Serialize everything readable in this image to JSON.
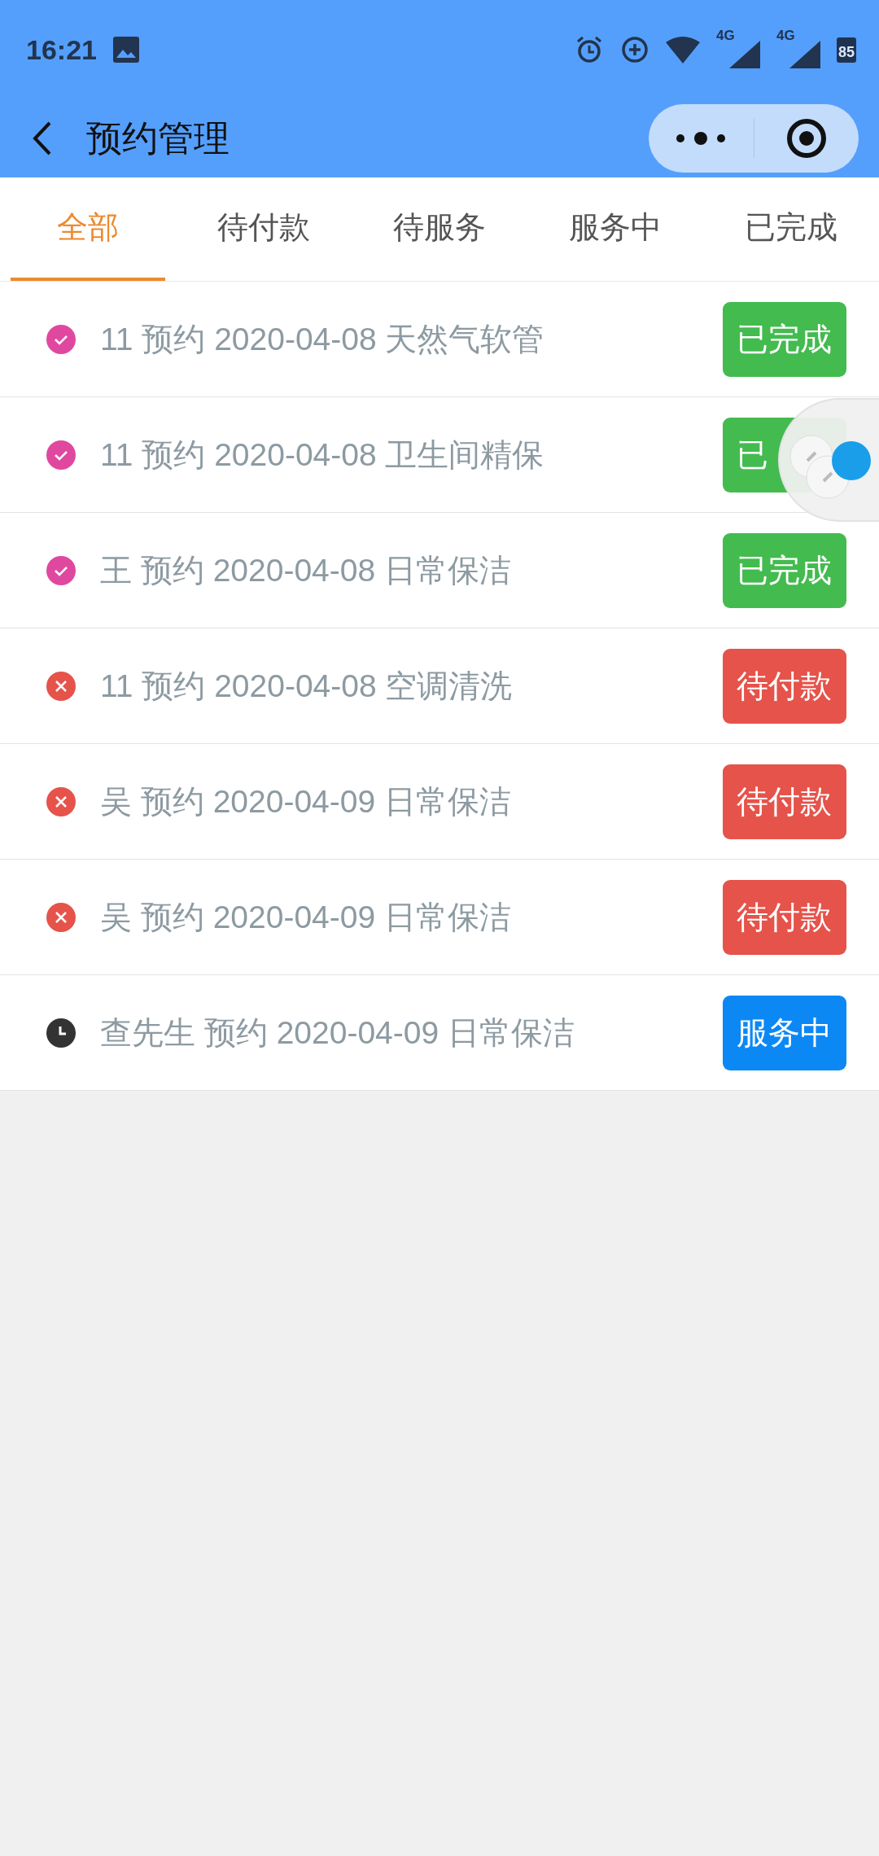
{
  "status_bar": {
    "time": "16:21",
    "networks": [
      "4G",
      "4G"
    ],
    "battery": "85"
  },
  "nav": {
    "title": "预约管理"
  },
  "tabs": [
    {
      "label": "全部",
      "selected": true
    },
    {
      "label": "待付款",
      "selected": false
    },
    {
      "label": "待服务",
      "selected": false
    },
    {
      "label": "服务中",
      "selected": false
    },
    {
      "label": "已完成",
      "selected": false
    }
  ],
  "appointments": [
    {
      "text": "11 预约 2020-04-08 天然气软管",
      "kind": "done",
      "badge": "已完成"
    },
    {
      "text": "11 预约 2020-04-08 卫生间精保",
      "kind": "done",
      "badge": "已"
    },
    {
      "text": "王 预约 2020-04-08 日常保洁",
      "kind": "done",
      "badge": "已完成"
    },
    {
      "text": "11 预约 2020-04-08 空调清洗",
      "kind": "unpaid",
      "badge": "待付款"
    },
    {
      "text": "吴 预约 2020-04-09 日常保洁",
      "kind": "unpaid",
      "badge": "待付款"
    },
    {
      "text": "吴 预约 2020-04-09 日常保洁",
      "kind": "unpaid",
      "badge": "待付款"
    },
    {
      "text": "查先生 预约 2020-04-09 日常保洁",
      "kind": "in_service",
      "badge": "服务中"
    }
  ]
}
